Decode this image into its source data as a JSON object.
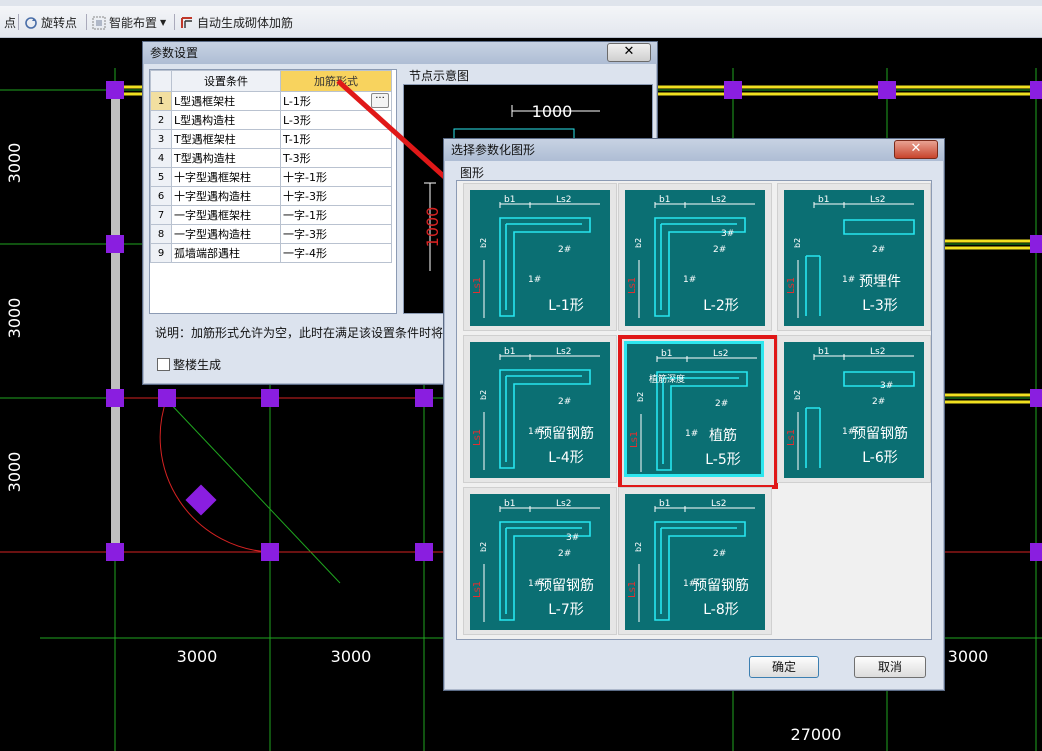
{
  "toolbar": {
    "partial_label": "点",
    "rotate_label": "旋转点",
    "smart_layout_label": "智能布置",
    "auto_rebar_label": "自动生成砌体加筋"
  },
  "cad": {
    "dim_3000": "3000",
    "dim_27000": "27000"
  },
  "param_dialog": {
    "title": "参数设置",
    "close_label": "✕",
    "col_condition": "设置条件",
    "col_form": "加筋形式",
    "node_preview_label": "节点示意图",
    "preview_dim_top": "1000",
    "preview_dim_left": "1000",
    "note": "说明：加筋形式允许为空，此时在满足该设置条件时将",
    "whole_building_label": "整楼生成",
    "rows": [
      {
        "n": "1",
        "cond": "L型遇框架柱",
        "form": "L-1形"
      },
      {
        "n": "2",
        "cond": "L型遇构造柱",
        "form": "L-3形"
      },
      {
        "n": "3",
        "cond": "T型遇框架柱",
        "form": "T-1形"
      },
      {
        "n": "4",
        "cond": "T型遇构造柱",
        "form": "T-3形"
      },
      {
        "n": "5",
        "cond": "十字型遇框架柱",
        "form": "十字-1形"
      },
      {
        "n": "6",
        "cond": "十字型遇构造柱",
        "form": "十字-3形"
      },
      {
        "n": "7",
        "cond": "一字型遇框架柱",
        "form": "一字-1形"
      },
      {
        "n": "8",
        "cond": "一字型遇构造柱",
        "form": "一字-3形"
      },
      {
        "n": "9",
        "cond": "孤墙端部遇柱",
        "form": "一字-4形"
      }
    ]
  },
  "shape_dialog": {
    "title": "选择参数化图形",
    "close_label": "✕",
    "group_label": "图形",
    "ok_label": "确定",
    "cancel_label": "取消",
    "shapes": [
      {
        "name": "L-1形",
        "extra": ""
      },
      {
        "name": "L-2形",
        "extra": ""
      },
      {
        "name": "L-3形",
        "extra": "预埋件"
      },
      {
        "name": "L-4形",
        "extra": "预留钢筋"
      },
      {
        "name": "L-5形",
        "extra": "植筋"
      },
      {
        "name": "L-6形",
        "extra": "预留钢筋"
      },
      {
        "name": "L-7形",
        "extra": "预留钢筋"
      },
      {
        "name": "L-8形",
        "extra": "预留钢筋"
      }
    ],
    "labels": {
      "b1": "b1",
      "b2": "b2",
      "ls2": "Ls2",
      "ls1": "Ls1",
      "r1": "1#",
      "r2": "2#",
      "r3": "3#",
      "depth": "植筋深度"
    }
  },
  "colors": {
    "teal": "#0b6f73",
    "cyan": "#27e6f0",
    "highlight": "#e01818",
    "beam": "#f0e020",
    "node": "#8a1ee0"
  }
}
